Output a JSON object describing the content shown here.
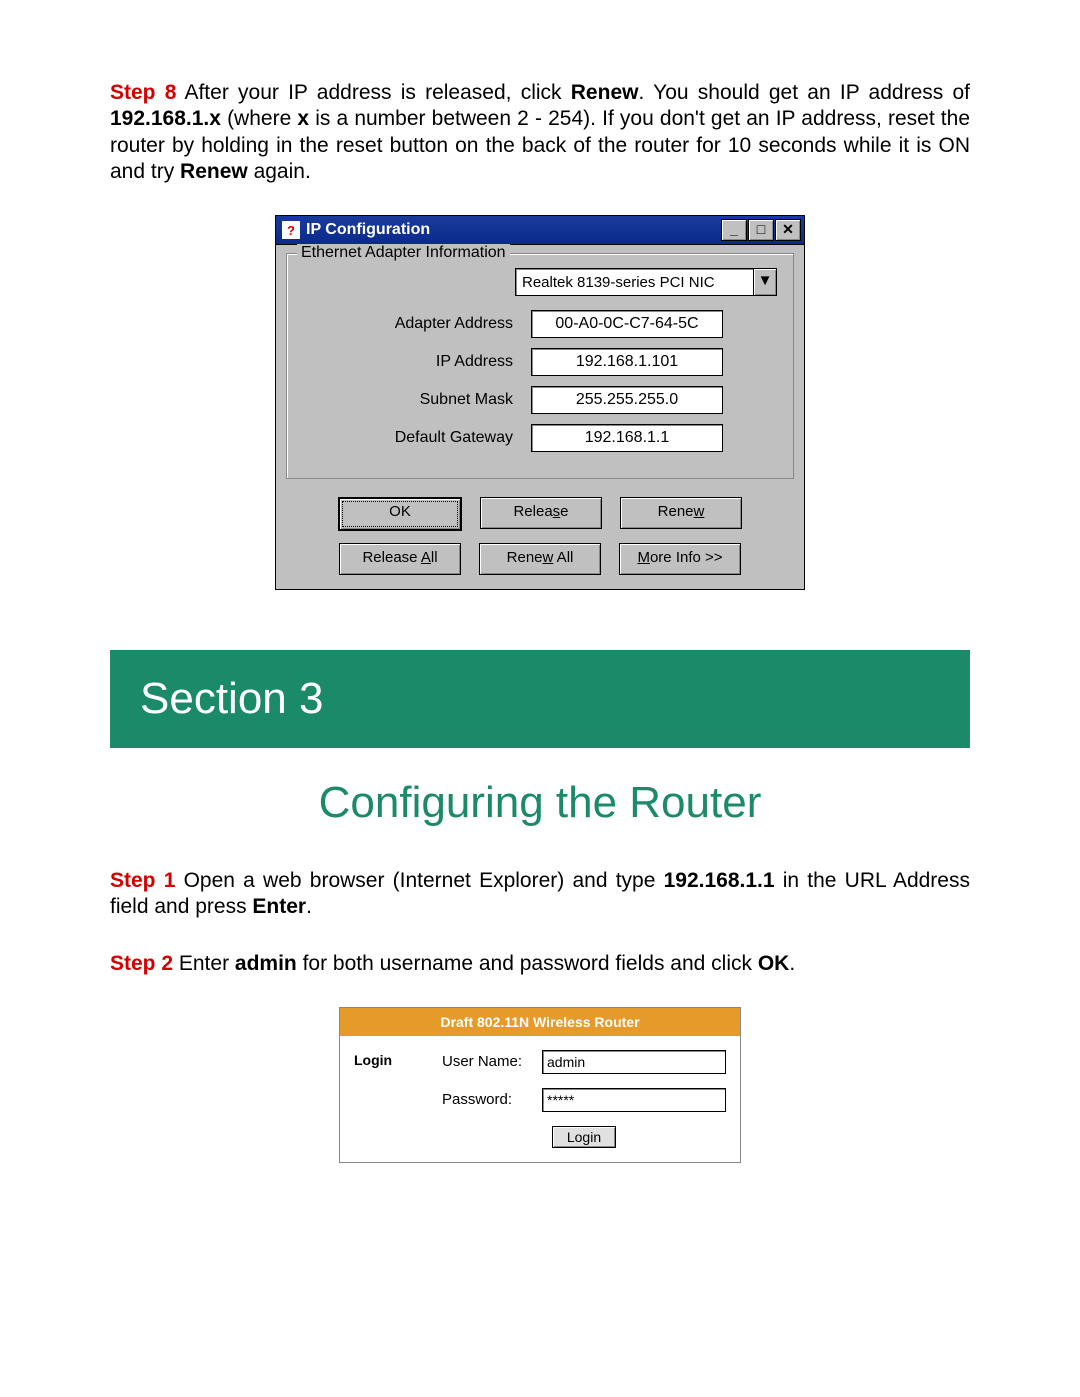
{
  "step8": {
    "label": "Step 8",
    "text1": " After your IP address is released, click ",
    "renew": "Renew",
    "text2": ". You should get an IP address of ",
    "ip_prefix": "192.168.1.x",
    "text3": " (where ",
    "x": "x",
    "text4": " is a number between 2 - 254). If you don't get an IP address, reset the router by holding in the reset button on the back of the router for 10 seconds while it is ON and try ",
    "renew2": "Renew",
    "text5": " again."
  },
  "ipcfg": {
    "title": "IP Configuration",
    "fieldset": "Ethernet Adapter Information",
    "adapter_dropdown": "Realtek 8139-series PCI NIC",
    "rows": {
      "adapter_addr_lbl": "Adapter Address",
      "adapter_addr_val": "00-A0-0C-C7-64-5C",
      "ip_addr_lbl": "IP Address",
      "ip_addr_val": "192.168.1.101",
      "subnet_lbl": "Subnet Mask",
      "subnet_val": "255.255.255.0",
      "gateway_lbl": "Default Gateway",
      "gateway_val": "192.168.1.1"
    },
    "buttons": {
      "ok": "OK",
      "release": "Release",
      "renew": "Renew",
      "release_all": "Release All",
      "renew_all": "Renew All",
      "more_info": "More Info >>"
    }
  },
  "section": {
    "banner": "Section 3",
    "title": "Configuring the Router"
  },
  "step1": {
    "label": "Step 1",
    "text1": " Open a web browser (Internet Explorer) and type ",
    "ip": "192.168.1.1",
    "text2": " in the URL Address field and press ",
    "enter": "Enter",
    "text3": "."
  },
  "step2": {
    "label": "Step 2",
    "text1": " Enter ",
    "admin": "admin",
    "text2": " for both username and password fields and click ",
    "ok": "OK",
    "text3": "."
  },
  "login": {
    "header": "Draft 802.11N Wireless Router",
    "side": "Login",
    "user_lbl": "User Name:",
    "user_val": "admin",
    "pass_lbl": "Password:",
    "pass_val": "*****",
    "btn": "Login"
  }
}
